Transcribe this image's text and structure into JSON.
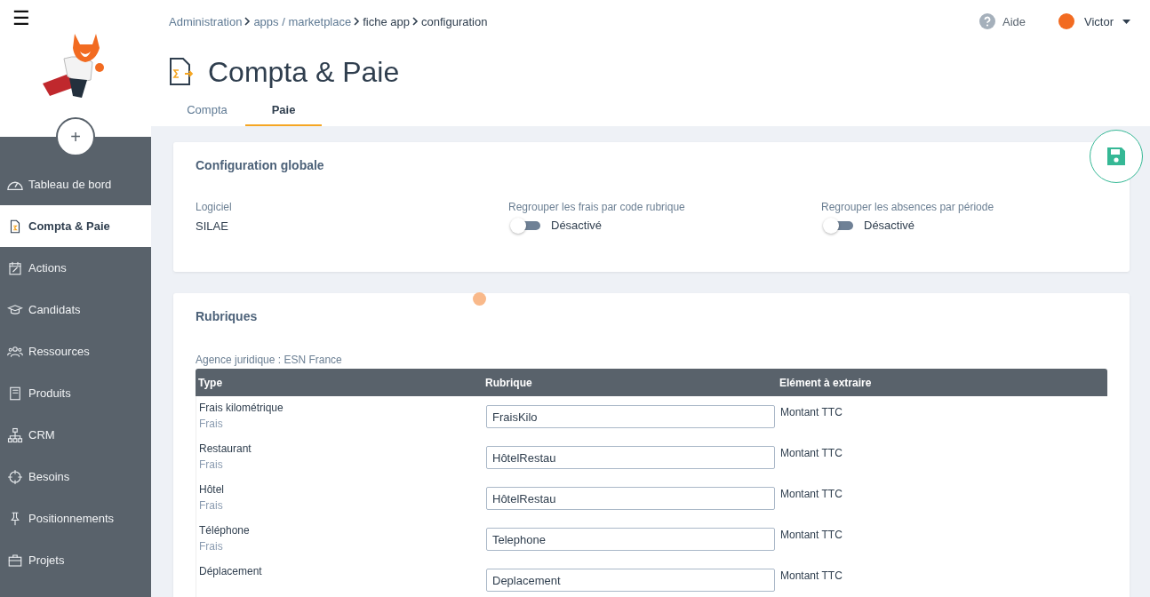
{
  "menu_button": "☰",
  "add_button": "+",
  "sidebar": {
    "items": [
      {
        "label": "Tableau de bord",
        "kind": "gauge",
        "selected": false
      },
      {
        "label": "Compta & Paie",
        "kind": "doc",
        "selected": true
      },
      {
        "label": "Actions",
        "kind": "calendar",
        "selected": false
      },
      {
        "label": "Candidats",
        "kind": "cap",
        "selected": false
      },
      {
        "label": "Ressources",
        "kind": "people",
        "selected": false
      },
      {
        "label": "Produits",
        "kind": "book",
        "selected": false
      },
      {
        "label": "CRM",
        "kind": "tree",
        "selected": false
      },
      {
        "label": "Besoins",
        "kind": "target",
        "selected": false
      },
      {
        "label": "Positionnements",
        "kind": "pin",
        "selected": false
      },
      {
        "label": "Projets",
        "kind": "case",
        "selected": false
      }
    ]
  },
  "breadcrumb": [
    {
      "label": "Administration",
      "link": true
    },
    {
      "label": "apps / marketplace",
      "link": true
    },
    {
      "label": "fiche app",
      "link": false
    },
    {
      "label": "configuration",
      "link": false
    }
  ],
  "help": "Aide",
  "user": "Victor",
  "title": "Compta & Paie",
  "tabs": [
    {
      "label": "Compta",
      "selected": false
    },
    {
      "label": "Paie",
      "selected": true
    }
  ],
  "global_config": {
    "title": "Configuration globale",
    "software": {
      "label": "Logiciel",
      "value": "SILAE"
    },
    "toggles": [
      {
        "label": "Regrouper les frais par code rubrique",
        "on": false,
        "state": "Désactivé"
      },
      {
        "label": "Regrouper les absences par période",
        "on": false,
        "state": "Désactivé"
      }
    ]
  },
  "rubriques": {
    "title": "Rubriques",
    "agency": "Agence juridique : ESN France",
    "columns": [
      "Type",
      "Rubrique",
      "Elément à extraire"
    ],
    "rows": [
      {
        "type": "Frais kilométrique",
        "category": "Frais",
        "rubrique": "FraisKilo",
        "element": "Montant TTC"
      },
      {
        "type": "Restaurant",
        "category": "Frais",
        "rubrique": "HôtelRestau",
        "element": "Montant TTC"
      },
      {
        "type": "Hôtel",
        "category": "Frais",
        "rubrique": "HôtelRestau",
        "element": "Montant TTC"
      },
      {
        "type": "Téléphone",
        "category": "Frais",
        "rubrique": "Telephone",
        "element": "Montant TTC"
      },
      {
        "type": "Déplacement",
        "rubrique": "Deplacement",
        "element": "Montant TTC"
      }
    ]
  }
}
